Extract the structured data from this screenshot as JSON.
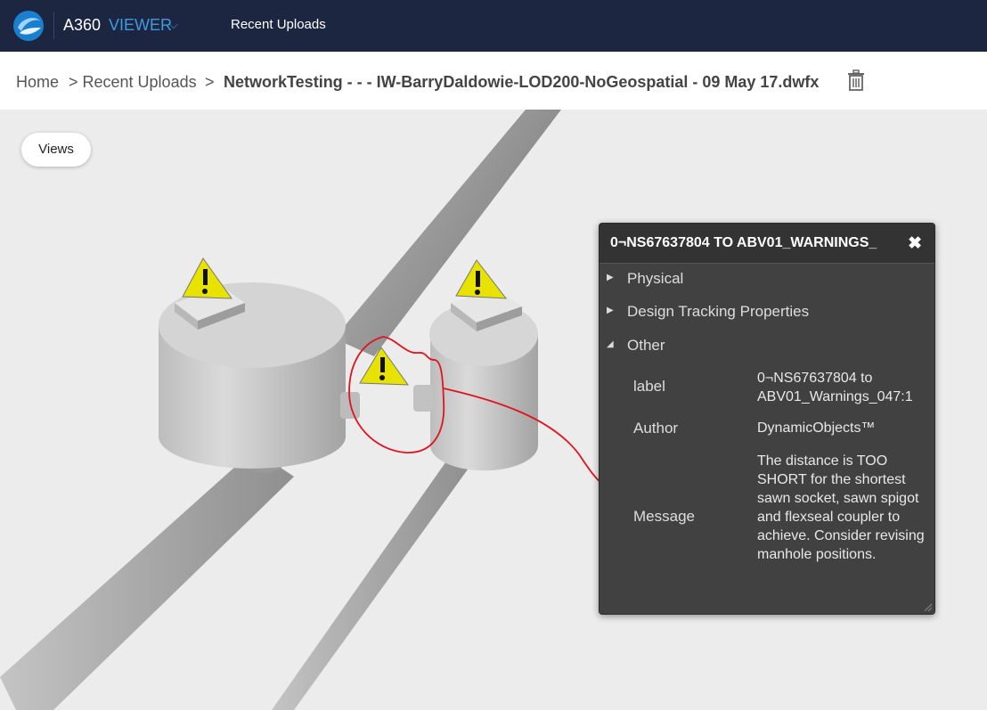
{
  "header": {
    "app_name": "A360",
    "app_mode": "VIEWER",
    "nav_link": "Recent Uploads"
  },
  "breadcrumb": {
    "home": "Home",
    "parent": "> Recent Uploads",
    "separator": ">",
    "current": "NetworkTesting - - - IW-BarryDaldowie-LOD200-NoGeospatial - 09 May 17.dwfx"
  },
  "views_button": "Views",
  "properties_panel": {
    "title": "0¬NS67637804 TO ABV01_WARNINGS_",
    "sections": [
      {
        "label": "Physical",
        "expanded": false
      },
      {
        "label": "Design Tracking Properties",
        "expanded": false
      },
      {
        "label": "Other",
        "expanded": true
      }
    ],
    "properties": [
      {
        "name": "label",
        "value": "0¬NS67637804 to ABV01_Warnings_047:1"
      },
      {
        "name": "Author",
        "value": "DynamicObjects™"
      },
      {
        "name": "Message",
        "value": "The distance is TOO SHORT for the shortest sawn socket, sawn spigot and flexseal coupler to achieve. Consider revising manhole positions."
      }
    ]
  },
  "icons": {
    "logo": "a360-logo-icon",
    "caret": "chevron-down-icon",
    "trash": "trash-icon",
    "close": "close-icon",
    "warning": "warning-icon"
  },
  "colors": {
    "topbar": "#1c2640",
    "accent": "#3f9ae0",
    "panel": "#414141",
    "annotation": "#e0141e",
    "warning": "#e8e200"
  }
}
